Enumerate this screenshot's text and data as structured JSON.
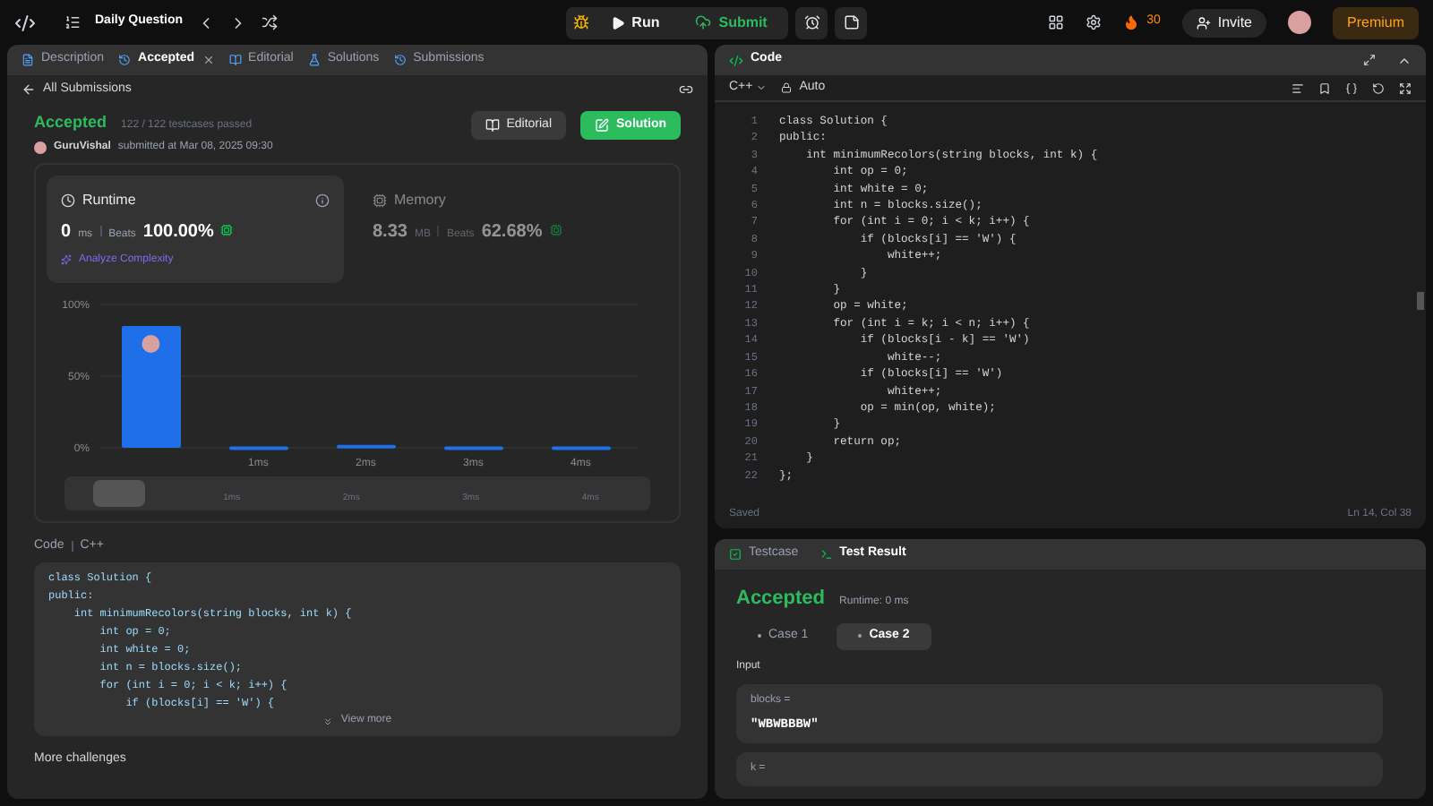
{
  "topbar": {
    "title": "Daily Question",
    "run": "Run",
    "submit": "Submit",
    "streak": "30",
    "invite": "Invite",
    "premium": "Premium"
  },
  "left_tabs": [
    {
      "label": "Description",
      "selected": false,
      "closable": false,
      "kind": "description"
    },
    {
      "label": "Accepted",
      "selected": true,
      "closable": true,
      "kind": "accepted"
    },
    {
      "label": "Editorial",
      "selected": false,
      "closable": false,
      "kind": "editorial"
    },
    {
      "label": "Solutions",
      "selected": false,
      "closable": false,
      "kind": "solutions"
    },
    {
      "label": "Submissions",
      "selected": false,
      "closable": false,
      "kind": "submissions"
    }
  ],
  "back_link": "All Submissions",
  "submission": {
    "status": "Accepted",
    "testcases": "122 / 122 testcases passed",
    "user": "GuruVishal",
    "submitted": "submitted at Mar 08, 2025 09:30",
    "editorial_button": "Editorial",
    "solution_button": "Solution"
  },
  "runtime": {
    "title": "Runtime",
    "value": "0",
    "unit": "ms",
    "beats_label": "Beats",
    "beats": "100.00%",
    "analyze": "Analyze Complexity",
    "selected": true
  },
  "memory": {
    "title": "Memory",
    "value": "8.33",
    "unit": "MB",
    "beats_label": "Beats",
    "beats": "62.68%",
    "selected": false
  },
  "chart_data": {
    "type": "bar",
    "categories": [
      null,
      "1ms",
      "2ms",
      "3ms",
      "4ms"
    ],
    "values": [
      85,
      1,
      2,
      1,
      1
    ],
    "ylim": [
      0,
      100
    ],
    "yticks": [
      {
        "value": 0,
        "label": "0%"
      },
      {
        "value": 50,
        "label": "50%"
      },
      {
        "value": 100,
        "label": "100%"
      }
    ]
  },
  "range": {
    "level": 0.05,
    "labels": [
      "1ms",
      "2ms",
      "3ms",
      "4ms"
    ]
  },
  "code_section": {
    "label": "Code",
    "language": "C++",
    "view_more": "View more",
    "lines": [
      "class Solution {",
      "public:",
      "    int minimumRecolors(string blocks, int k) {",
      "        int op = 0;",
      "        int white = 0;",
      "        int n = blocks.size();",
      "        for (int i = 0; i < k; i++) {",
      "            if (blocks[i] == 'W') {"
    ]
  },
  "more_challenges": "More challenges",
  "editor": {
    "title": "Code",
    "language": "C++",
    "mode": "Auto",
    "saved": "Saved",
    "cursor": "Ln 14, Col 38",
    "lines": [
      {
        "n": "1",
        "code": "class Solution {"
      },
      {
        "n": "2",
        "code": "public:"
      },
      {
        "n": "3",
        "code": "    int minimumRecolors(string blocks, int k) {"
      },
      {
        "n": "4",
        "code": "        int op = 0;"
      },
      {
        "n": "5",
        "code": "        int white = 0;"
      },
      {
        "n": "6",
        "code": "        int n = blocks.size();"
      },
      {
        "n": "7",
        "code": "        for (int i = 0; i < k; i++) {"
      },
      {
        "n": "8",
        "code": "            if (blocks[i] == 'W') {"
      },
      {
        "n": "9",
        "code": "                white++;"
      },
      {
        "n": "10",
        "code": "            }"
      },
      {
        "n": "11",
        "code": "        }"
      },
      {
        "n": "12",
        "code": "        op = white;"
      },
      {
        "n": "13",
        "code": "        for (int i = k; i < n; i++) {"
      },
      {
        "n": "14",
        "code": "            if (blocks[i - k] == 'W')"
      },
      {
        "n": "15",
        "code": "                white--;"
      },
      {
        "n": "16",
        "code": "            if (blocks[i] == 'W')"
      },
      {
        "n": "17",
        "code": "                white++;"
      },
      {
        "n": "18",
        "code": "            op = min(op, white);"
      },
      {
        "n": "19",
        "code": "        }"
      },
      {
        "n": "20",
        "code": "        return op;"
      },
      {
        "n": "21",
        "code": "    }"
      },
      {
        "n": "22",
        "code": "};"
      }
    ]
  },
  "bottom_tabs": [
    {
      "label": "Testcase",
      "selected": false
    },
    {
      "label": "Test Result",
      "selected": true
    }
  ],
  "result": {
    "status": "Accepted",
    "runtime": "Runtime: 0 ms",
    "cases": [
      {
        "label": "Case 1",
        "selected": false
      },
      {
        "label": "Case 2",
        "selected": true
      }
    ],
    "input_label": "Input",
    "inputs": [
      {
        "name": "blocks =",
        "value": "\"WBWBBBW\""
      },
      {
        "name": "k ="
      }
    ]
  }
}
